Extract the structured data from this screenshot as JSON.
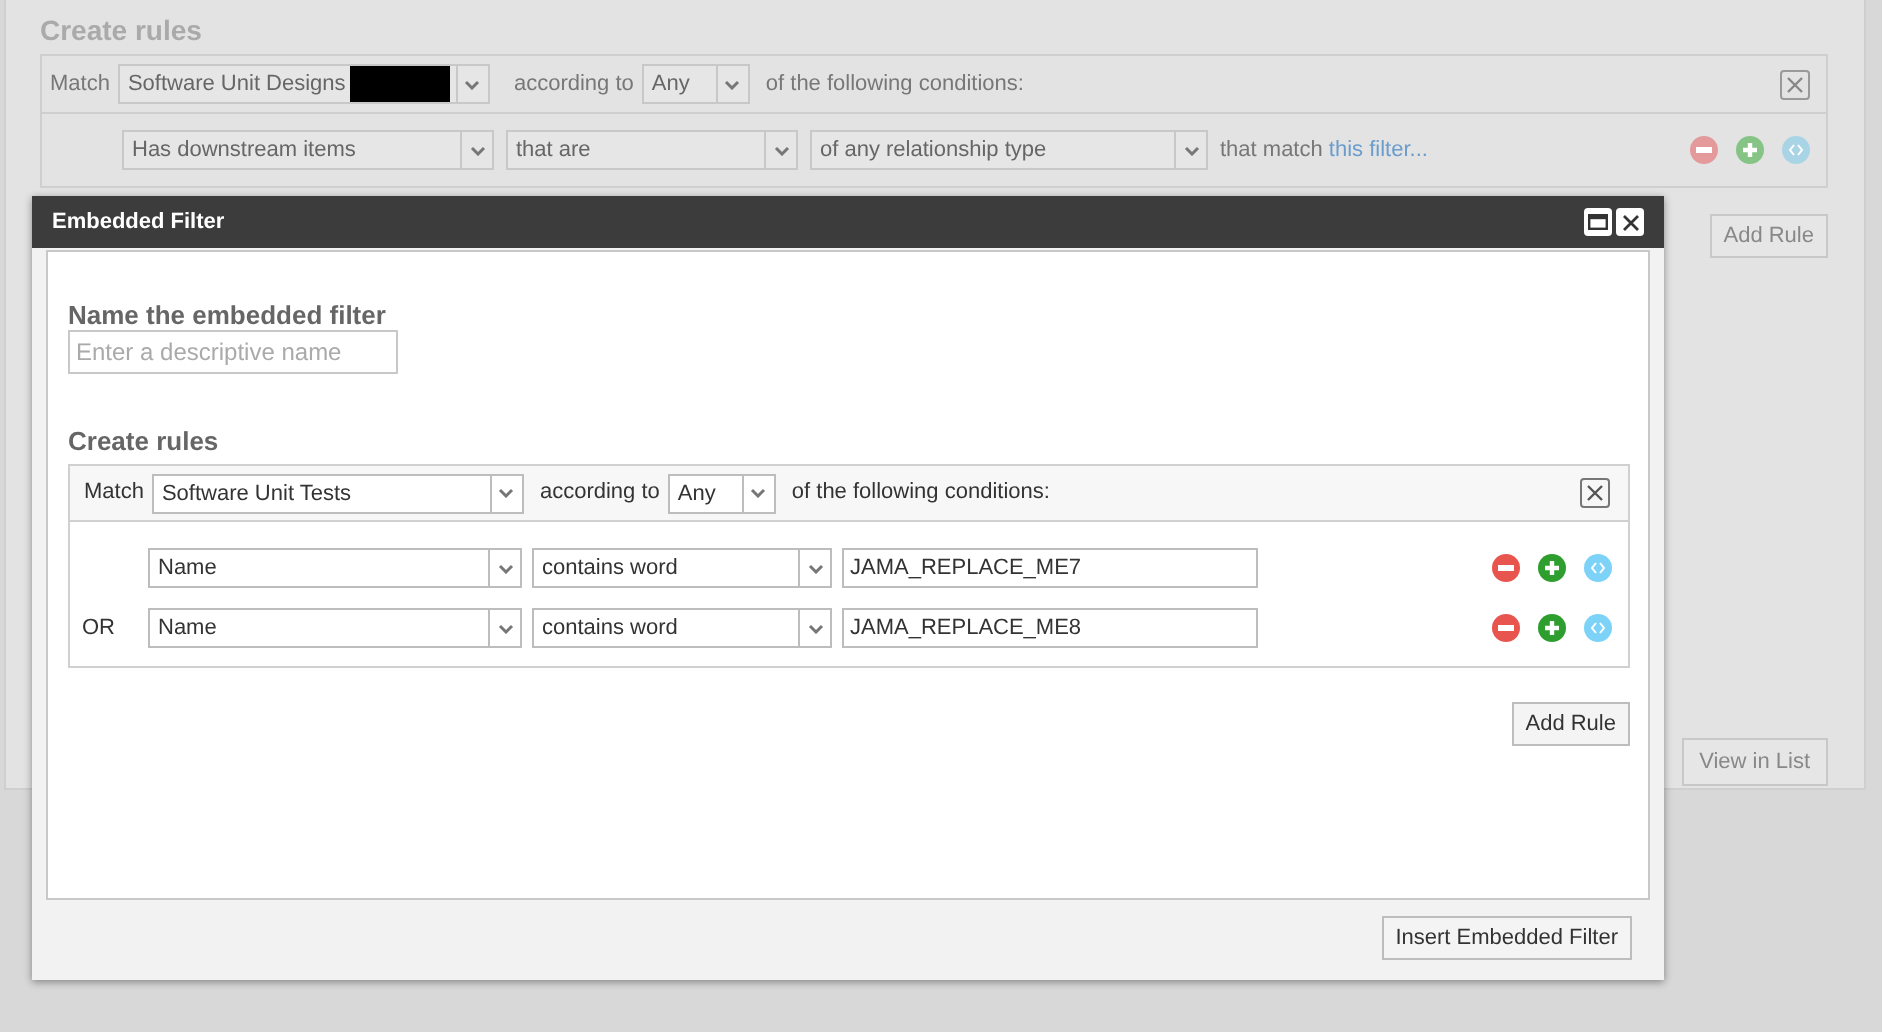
{
  "background_form": {
    "title": "Create rules",
    "match_label": "Match",
    "item_type": "Software Unit Designs",
    "according_to": "according to",
    "mode": "Any",
    "suffix": "of the following conditions:",
    "rules": [
      {
        "field": "Has downstream items",
        "operator": "that are",
        "relation": "of any relationship type",
        "match_text": "that match",
        "link": "this filter..."
      }
    ],
    "add_rule": "Add Rule",
    "view_in_list": "View in List"
  },
  "dialog": {
    "title": "Embedded Filter",
    "name_label": "Name the embedded filter",
    "name_placeholder": "Enter a descriptive name",
    "rules_title": "Create rules",
    "match_label": "Match",
    "item_type": "Software Unit Tests",
    "according_to": "according to",
    "mode": "Any",
    "suffix": "of the following conditions:",
    "rules": [
      {
        "field": "Name",
        "operator": "contains word",
        "value": "JAMA_REPLACE_ME7"
      },
      {
        "conjunction": "OR",
        "field": "Name",
        "operator": "contains word",
        "value": "JAMA_REPLACE_ME8"
      }
    ],
    "add_rule": "Add Rule",
    "insert_button": "Insert Embedded Filter"
  }
}
